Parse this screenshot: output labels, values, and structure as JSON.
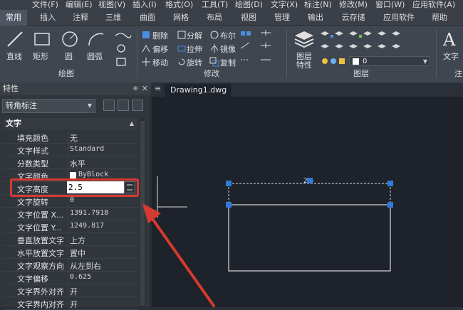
{
  "menu": [
    "文件(F)",
    "编辑(E)",
    "视图(V)",
    "插入(I)",
    "格式(O)",
    "工具(T)",
    "绘图(D)",
    "文字(X)",
    "标注(N)",
    "修改(M)",
    "窗口(W)",
    "应用软件(A)"
  ],
  "tabs": [
    "常用",
    "插入",
    "注释",
    "三维",
    "曲面",
    "网格",
    "布局",
    "视图",
    "管理",
    "输出",
    "云存储",
    "应用软件",
    "帮助"
  ],
  "ribbon": {
    "draw": {
      "line": "直线",
      "rect": "矩形",
      "circle": "圆",
      "arc": "圆弧",
      "group": "绘图"
    },
    "modify": {
      "delete": "删除",
      "explode": "分解",
      "boolean": "布尔",
      "offset": "偏移",
      "stretch": "拉伸",
      "mirror": "镜像",
      "move": "移动",
      "rotate": "旋转",
      "copy": "复制",
      "group": "修改"
    },
    "layer": {
      "props": "图层\n特性",
      "props1": "图层",
      "props2": "特性",
      "current": "0",
      "group": "图层"
    },
    "text": {
      "label": "文字",
      "group": "注"
    }
  },
  "props": {
    "title": "特性",
    "selector": "转角标注",
    "section": "文字",
    "rows": [
      {
        "k": "填充颜色",
        "v": "无"
      },
      {
        "k": "文字样式",
        "v": "Standard"
      },
      {
        "k": "分数类型",
        "v": "水平"
      },
      {
        "k": "文字颜色",
        "v": "ByBlock"
      },
      {
        "k": "文字高度",
        "v": "2.5"
      },
      {
        "k": "文字旋转",
        "v": "0"
      },
      {
        "k": "文字位置 X...",
        "v": "1391.7918"
      },
      {
        "k": "文字位置 Y...",
        "v": "1249.817"
      },
      {
        "k": "垂直放置文字",
        "v": "上方"
      },
      {
        "k": "水平放置文字",
        "v": "置中"
      },
      {
        "k": "文字观察方向",
        "v": "从左到右"
      },
      {
        "k": "文字偏移",
        "v": "0.625"
      },
      {
        "k": "文字界外对齐",
        "v": "开"
      },
      {
        "k": "文字界内对齐",
        "v": "开"
      }
    ]
  },
  "doc": {
    "tab": "Drawing1.dwg",
    "dimText": "2.5"
  },
  "colors": {
    "accent": "#d63a2f",
    "grip": "#2f7bd9",
    "canvas": "#1d222b"
  }
}
